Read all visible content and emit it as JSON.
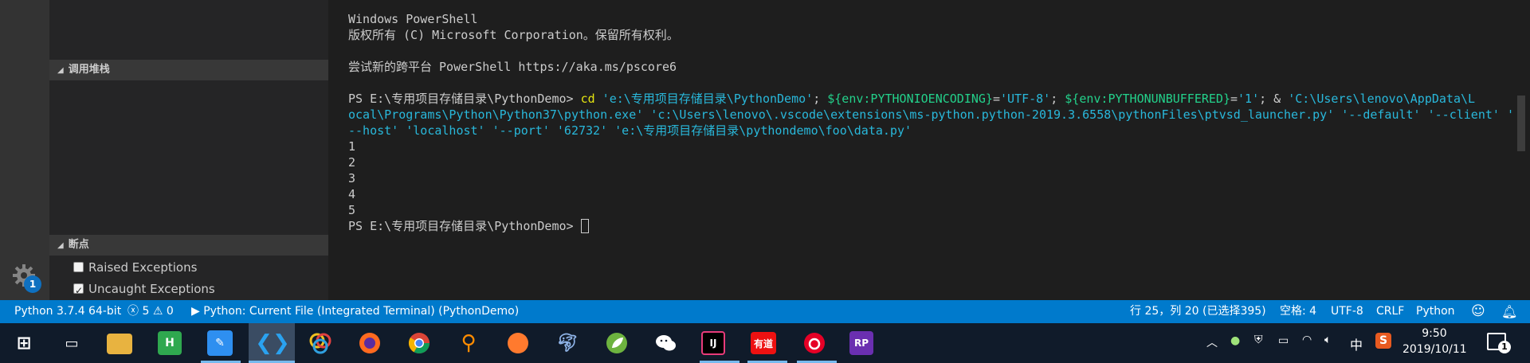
{
  "sidebar": {
    "call_stack_header": "调用堆栈",
    "breakpoints_header": "断点",
    "breakpoints": [
      {
        "label": "Raised Exceptions",
        "checked": false
      },
      {
        "label": "Uncaught Exceptions",
        "checked": true
      }
    ],
    "settings_badge": "1"
  },
  "terminal": {
    "line1": "Windows PowerShell",
    "line2": "版权所有 (C) Microsoft Corporation。保留所有权利。",
    "line3": "尝试新的跨平台 PowerShell https://aka.ms/pscore6",
    "prompt": "PS E:\\专用项目存储目录\\PythonDemo> ",
    "cmd_cd": "cd",
    "cmd_path1": " 'e:\\专用项目存储目录\\PythonDemo'",
    "cmd_sep1": "; ",
    "cmd_env1": "${env:PYTHONIOENCODING}",
    "cmd_eq1": "=",
    "cmd_val1": "'UTF-8'",
    "cmd_sep2": "; ",
    "cmd_env2": "${env:PYTHONUNBUFFERED}",
    "cmd_eq2": "=",
    "cmd_val2": "'1'",
    "cmd_sep3": "; & ",
    "cmd_exe_a": "'C:\\Users\\lenovo\\AppData\\L",
    "cmd_exe_b": "ocal\\Programs\\Python\\Python37\\python.exe'",
    "cmd_arg1": " 'c:\\Users\\lenovo\\.vscode\\extensions\\ms-python.python-2019.3.6558\\pythonFiles\\ptvsd_launcher.py'",
    "cmd_arg2": " '--default' '--client' '",
    "cmd_arg3": "--host' 'localhost' '--port' '62732' 'e:\\专用项目存储目录\\pythondemo\\foo\\data.py'",
    "output": [
      "1",
      "2",
      "3",
      "4",
      "5"
    ],
    "final_prompt": "PS E:\\专用项目存储目录\\PythonDemo> "
  },
  "statusbar": {
    "interpreter": "Python 3.7.4 64-bit",
    "errors": "5",
    "warnings": "0",
    "run_config": "Python: Current File (Integrated Terminal) (PythonDemo)",
    "cursor_pos": "行 25，列 20 (已选择395)",
    "indent": "空格: 4",
    "encoding": "UTF-8",
    "eol": "CRLF",
    "language": "Python"
  },
  "taskbar": {
    "time": "9:50",
    "date": "2019/10/11",
    "ime": "中",
    "notification_count": "1",
    "apps": [
      "start-icon",
      "task-view-icon",
      "file-explorer-icon",
      "hbuilder-icon",
      "pen-app-icon",
      "vscode-icon",
      "color-app-icon",
      "firefox-icon",
      "chrome-icon",
      "search-app-icon",
      "safari-icon",
      "dolphin-icon",
      "leaf-app-icon",
      "wechat-icon",
      "intellij-icon",
      "youdao-icon",
      "netease-music-icon",
      "axure-icon"
    ],
    "colors": {
      "accent": "#007acc",
      "taskbar": "#101b2a"
    }
  }
}
